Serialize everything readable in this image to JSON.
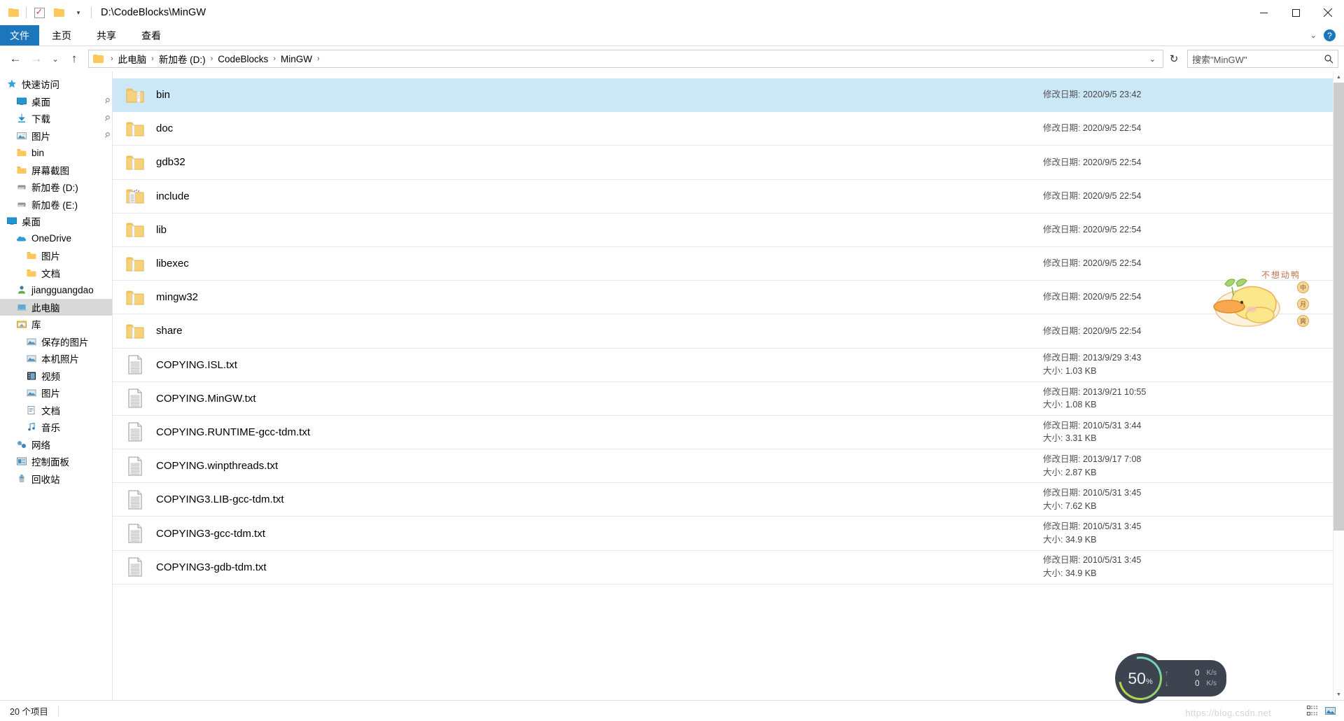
{
  "titlebar": {
    "path": "D:\\CodeBlocks\\MinGW",
    "qat_folder": "folder-icon",
    "qat_properties": "properties-icon",
    "qat_newfolder": "new-folder-icon",
    "qat_more": "▾",
    "minimize": "—",
    "maximize": "□",
    "close": "✕"
  },
  "ribbon": {
    "tabs": [
      {
        "label": "文件",
        "active": true
      },
      {
        "label": "主页",
        "active": false
      },
      {
        "label": "共享",
        "active": false
      },
      {
        "label": "查看",
        "active": false
      }
    ],
    "expand_caret": "⌄",
    "help": "?"
  },
  "address": {
    "back": "←",
    "forward": "→",
    "recent": "⌄",
    "up": "↑",
    "crumbs": [
      "此电脑",
      "新加卷 (D:)",
      "CodeBlocks",
      "MinGW"
    ],
    "separator": "›",
    "dropdown": "⌄",
    "refresh": "↻"
  },
  "search": {
    "placeholder": "搜索\"MinGW\"",
    "icon": "search-icon"
  },
  "sidebar": {
    "items": [
      {
        "label": "快速访问",
        "icon": "star-icon",
        "indent": 0,
        "pinned": false,
        "selected": false
      },
      {
        "label": "桌面",
        "icon": "desktop-icon",
        "indent": 1,
        "pinned": true,
        "selected": false
      },
      {
        "label": "下载",
        "icon": "download-icon",
        "indent": 1,
        "pinned": true,
        "selected": false
      },
      {
        "label": "图片",
        "icon": "pictures-icon",
        "indent": 1,
        "pinned": true,
        "selected": false
      },
      {
        "label": "bin",
        "icon": "folder-icon",
        "indent": 1,
        "pinned": false,
        "selected": false
      },
      {
        "label": "屏幕截图",
        "icon": "folder-icon",
        "indent": 1,
        "pinned": false,
        "selected": false
      },
      {
        "label": "新加卷 (D:)",
        "icon": "drive-icon",
        "indent": 1,
        "pinned": false,
        "selected": false
      },
      {
        "label": "新加卷 (E:)",
        "icon": "drive-icon",
        "indent": 1,
        "pinned": false,
        "selected": false
      },
      {
        "label": "桌面",
        "icon": "desktop-icon",
        "indent": 0,
        "pinned": false,
        "selected": false
      },
      {
        "label": "OneDrive",
        "icon": "onedrive-icon",
        "indent": 1,
        "pinned": false,
        "selected": false
      },
      {
        "label": "图片",
        "icon": "folder-icon",
        "indent": 2,
        "pinned": false,
        "selected": false
      },
      {
        "label": "文档",
        "icon": "folder-icon",
        "indent": 2,
        "pinned": false,
        "selected": false
      },
      {
        "label": "jiangguangdao",
        "icon": "user-icon",
        "indent": 1,
        "pinned": false,
        "selected": false
      },
      {
        "label": "此电脑",
        "icon": "computer-icon",
        "indent": 1,
        "pinned": false,
        "selected": true
      },
      {
        "label": "库",
        "icon": "library-icon",
        "indent": 1,
        "pinned": false,
        "selected": false
      },
      {
        "label": "保存的图片",
        "icon": "library-pictures-icon",
        "indent": 2,
        "pinned": false,
        "selected": false
      },
      {
        "label": "本机照片",
        "icon": "library-pictures-icon",
        "indent": 2,
        "pinned": false,
        "selected": false
      },
      {
        "label": "视频",
        "icon": "library-video-icon",
        "indent": 2,
        "pinned": false,
        "selected": false
      },
      {
        "label": "图片",
        "icon": "library-pictures-icon",
        "indent": 2,
        "pinned": false,
        "selected": false
      },
      {
        "label": "文档",
        "icon": "library-documents-icon",
        "indent": 2,
        "pinned": false,
        "selected": false
      },
      {
        "label": "音乐",
        "icon": "library-music-icon",
        "indent": 2,
        "pinned": false,
        "selected": false
      },
      {
        "label": "网络",
        "icon": "network-icon",
        "indent": 1,
        "pinned": false,
        "selected": false
      },
      {
        "label": "控制面板",
        "icon": "control-panel-icon",
        "indent": 1,
        "pinned": false,
        "selected": false
      },
      {
        "label": "回收站",
        "icon": "recycle-bin-icon",
        "indent": 1,
        "pinned": false,
        "selected": false
      }
    ]
  },
  "filelist": {
    "date_label": "修改日期:",
    "size_label": "大小:",
    "rows": [
      {
        "name": "bin",
        "type": "folder-open",
        "date": "2020/9/5 23:42",
        "size": "",
        "selected": true
      },
      {
        "name": "doc",
        "type": "folder",
        "date": "2020/9/5 22:54",
        "size": "",
        "selected": false
      },
      {
        "name": "gdb32",
        "type": "folder",
        "date": "2020/9/5 22:54",
        "size": "",
        "selected": false
      },
      {
        "name": "include",
        "type": "folder-code",
        "date": "2020/9/5 22:54",
        "size": "",
        "selected": false
      },
      {
        "name": "lib",
        "type": "folder",
        "date": "2020/9/5 22:54",
        "size": "",
        "selected": false
      },
      {
        "name": "libexec",
        "type": "folder",
        "date": "2020/9/5 22:54",
        "size": "",
        "selected": false
      },
      {
        "name": "mingw32",
        "type": "folder",
        "date": "2020/9/5 22:54",
        "size": "",
        "selected": false
      },
      {
        "name": "share",
        "type": "folder",
        "date": "2020/9/5 22:54",
        "size": "",
        "selected": false
      },
      {
        "name": "COPYING.ISL.txt",
        "type": "text",
        "date": "2013/9/29 3:43",
        "size": "1.03 KB",
        "selected": false
      },
      {
        "name": "COPYING.MinGW.txt",
        "type": "text",
        "date": "2013/9/21 10:55",
        "size": "1.08 KB",
        "selected": false
      },
      {
        "name": "COPYING.RUNTIME-gcc-tdm.txt",
        "type": "text",
        "date": "2010/5/31 3:44",
        "size": "3.31 KB",
        "selected": false
      },
      {
        "name": "COPYING.winpthreads.txt",
        "type": "text",
        "date": "2013/9/17 7:08",
        "size": "2.87 KB",
        "selected": false
      },
      {
        "name": "COPYING3.LIB-gcc-tdm.txt",
        "type": "text",
        "date": "2010/5/31 3:45",
        "size": "7.62 KB",
        "selected": false
      },
      {
        "name": "COPYING3-gcc-tdm.txt",
        "type": "text",
        "date": "2010/5/31 3:45",
        "size": "34.9 KB",
        "selected": false
      },
      {
        "name": "COPYING3-gdb-tdm.txt",
        "type": "text",
        "date": "2010/5/31 3:45",
        "size": "34.9 KB",
        "selected": false
      }
    ]
  },
  "statusbar": {
    "item_count": "20 个项目",
    "view_details": "details-view-icon",
    "view_large": "large-icons-view-icon"
  },
  "overlay": {
    "mascot_text": "不想动鸭",
    "badges": [
      "中",
      "月",
      "爽"
    ],
    "watermark": "https://blog.csdn.net"
  },
  "network_widget": {
    "percent": "50",
    "percent_symbol": "%",
    "upload_arrow": "↑",
    "upload_value": "0",
    "upload_unit": "K/s",
    "download_arrow": "↓",
    "download_value": "0",
    "download_unit": "K/s"
  },
  "colors": {
    "accent": "#1b76bc",
    "selection": "#cce8f7",
    "folder": "#fcc75b"
  }
}
